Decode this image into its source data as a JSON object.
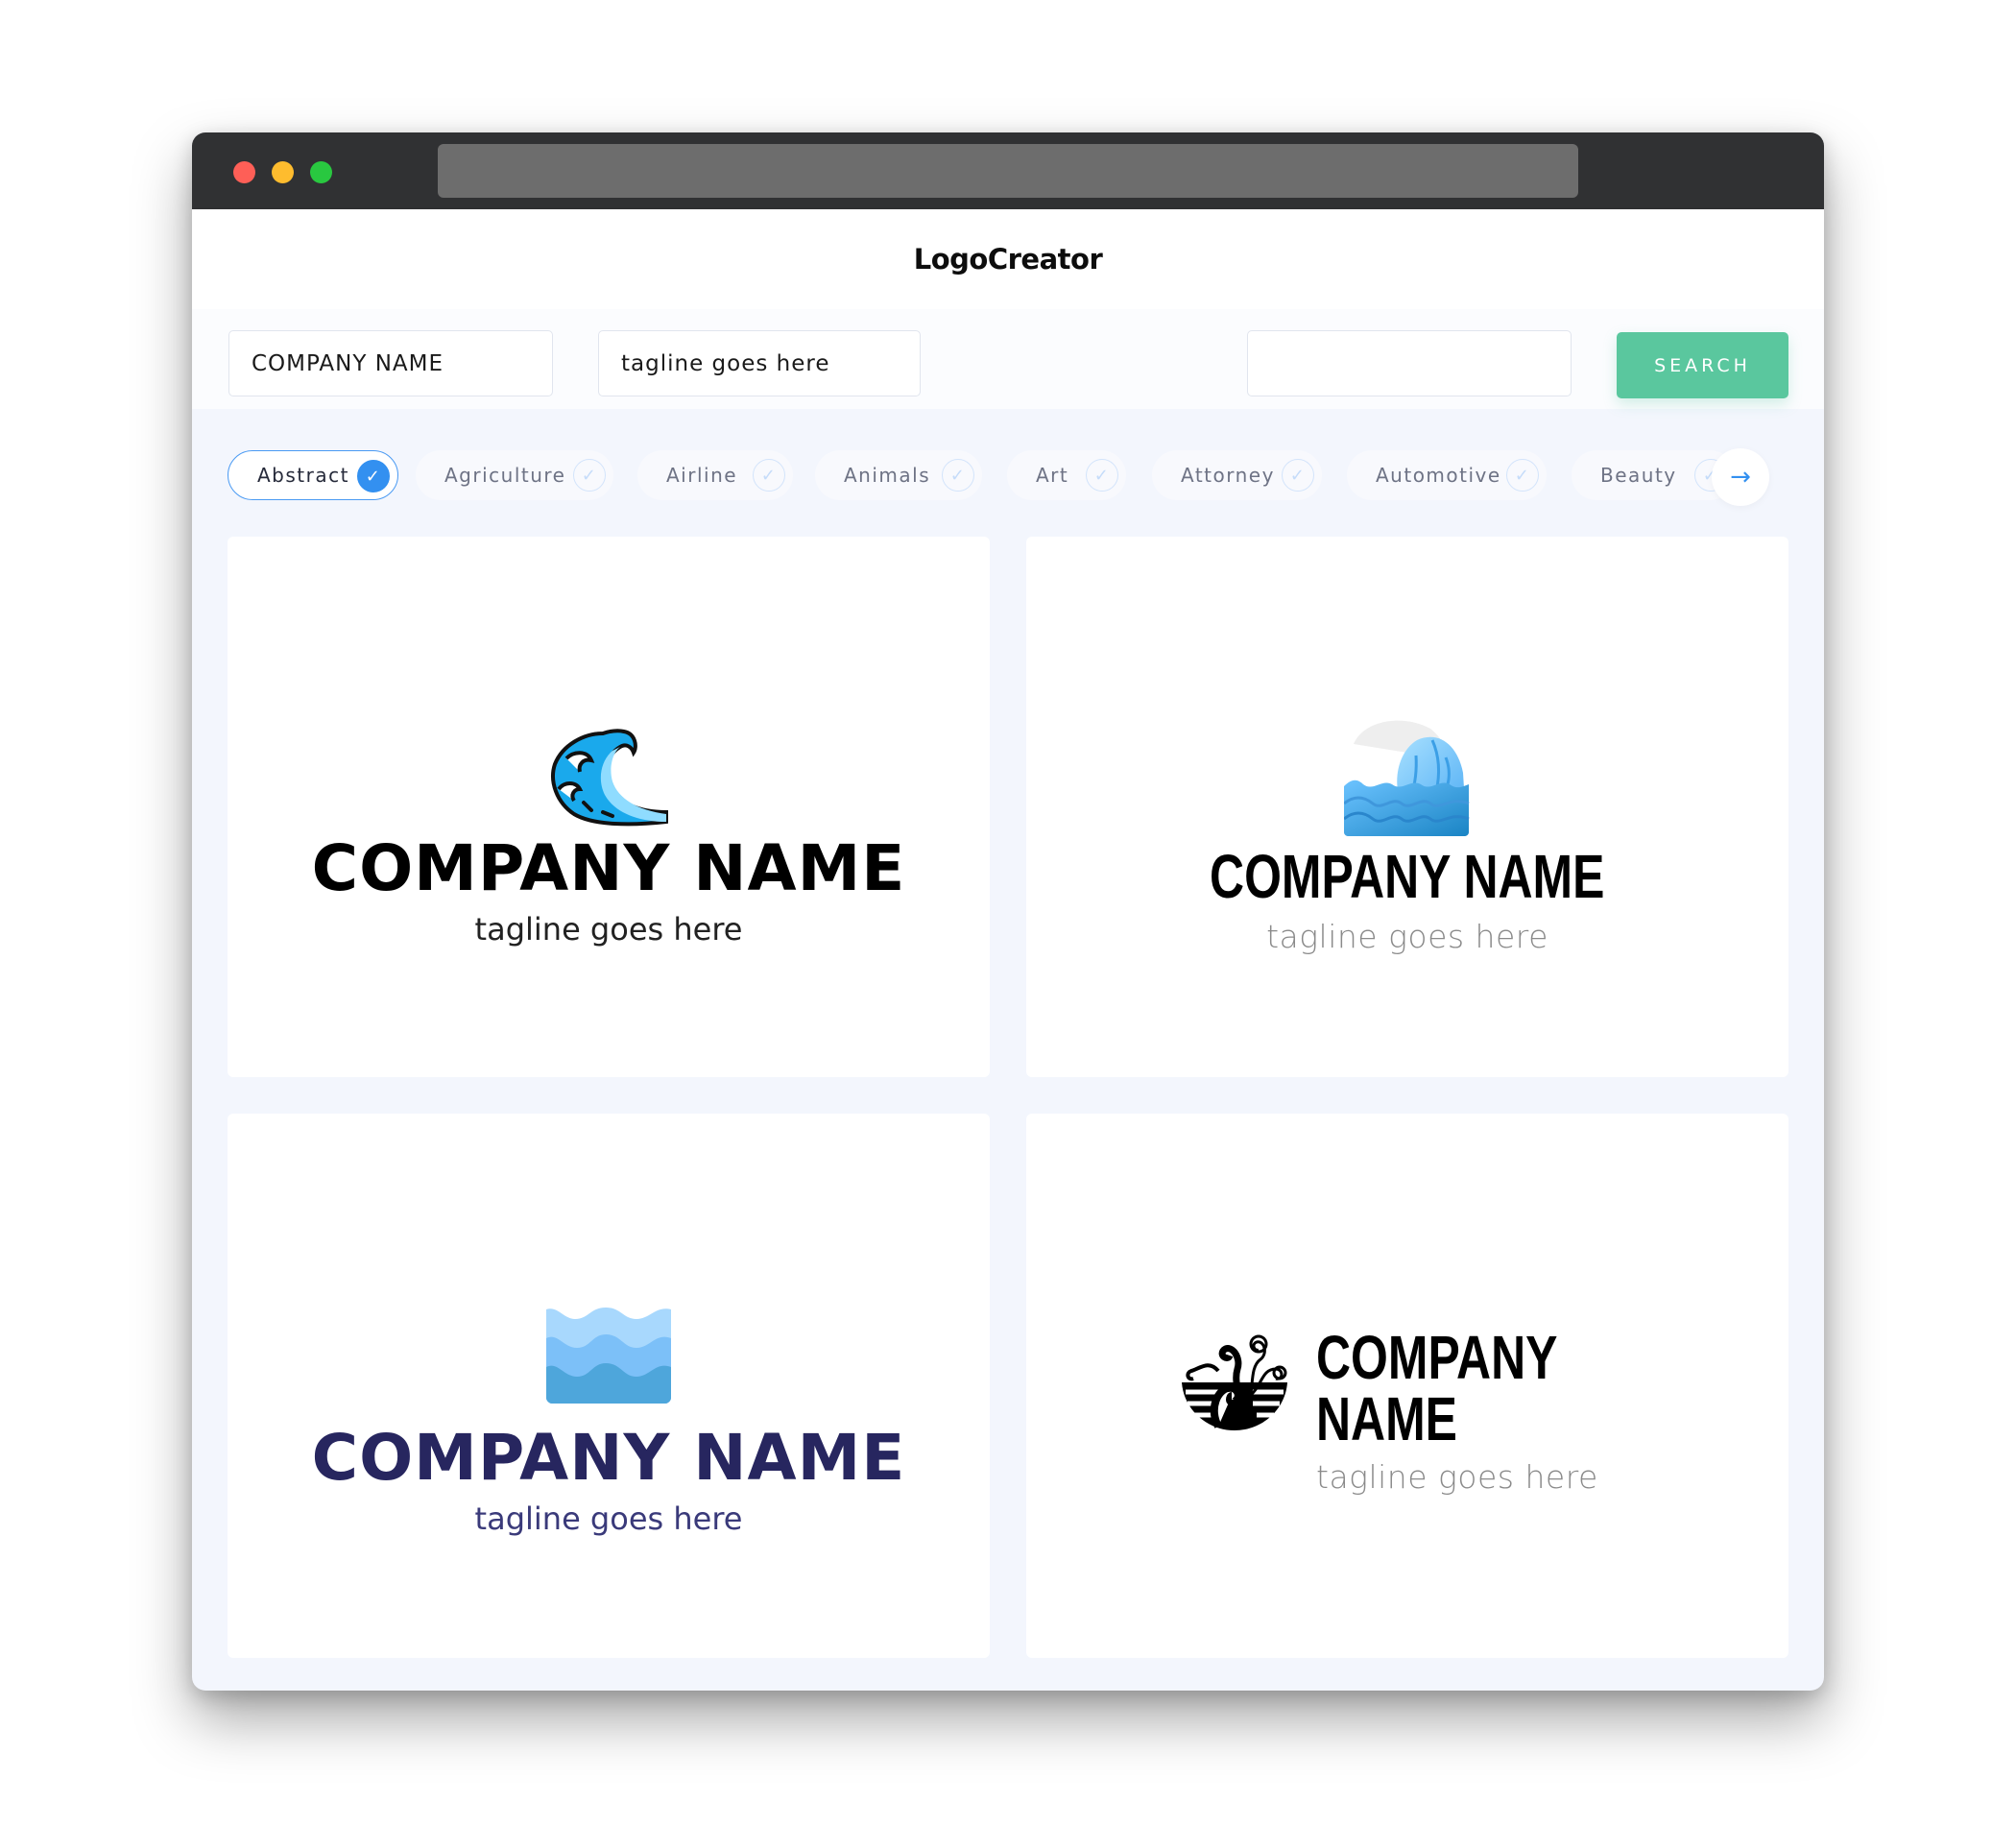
{
  "window": {
    "controls": [
      "close",
      "minimize",
      "maximize"
    ],
    "url": ""
  },
  "header": {
    "title": "LogoCreator"
  },
  "search": {
    "company_name_value": "COMPANY NAME",
    "tagline_value": "tagline goes here",
    "keyword_value": "",
    "button_label": "SEARCH"
  },
  "categories": {
    "items": [
      {
        "label": "Abstract",
        "selected": true
      },
      {
        "label": "Agriculture",
        "selected": false
      },
      {
        "label": "Airline",
        "selected": false
      },
      {
        "label": "Animals",
        "selected": false
      },
      {
        "label": "Art",
        "selected": false
      },
      {
        "label": "Attorney",
        "selected": false
      },
      {
        "label": "Automotive",
        "selected": false
      },
      {
        "label": "Beauty",
        "selected": false
      }
    ],
    "check_icon": "checkmark-icon",
    "next_icon": "arrow-right-icon"
  },
  "logos": [
    {
      "icon": "wave-outline-icon",
      "company": "COMPANY NAME",
      "tagline": "tagline goes here",
      "name_color": "#000000",
      "tagline_color": "#222222"
    },
    {
      "icon": "wave-gradient-icon",
      "company": "COMPANY NAME",
      "tagline": "tagline goes here",
      "name_color": "#000000",
      "tagline_color": "#8a8a8a"
    },
    {
      "icon": "water-layers-icon",
      "company": "COMPANY NAME",
      "tagline": "tagline goes here",
      "name_color": "#27265f",
      "tagline_color": "#3a3a7a"
    },
    {
      "icon": "swirl-wave-circle-icon",
      "company": "COMPANY NAME",
      "tagline": "tagline goes here",
      "name_color": "#000000",
      "tagline_color": "#8a8a8a"
    }
  ],
  "colors": {
    "accent": "#3390f0",
    "search_button": "#5ac79e",
    "titlebar": "#303133",
    "page_bg": "#f3f6fd"
  }
}
